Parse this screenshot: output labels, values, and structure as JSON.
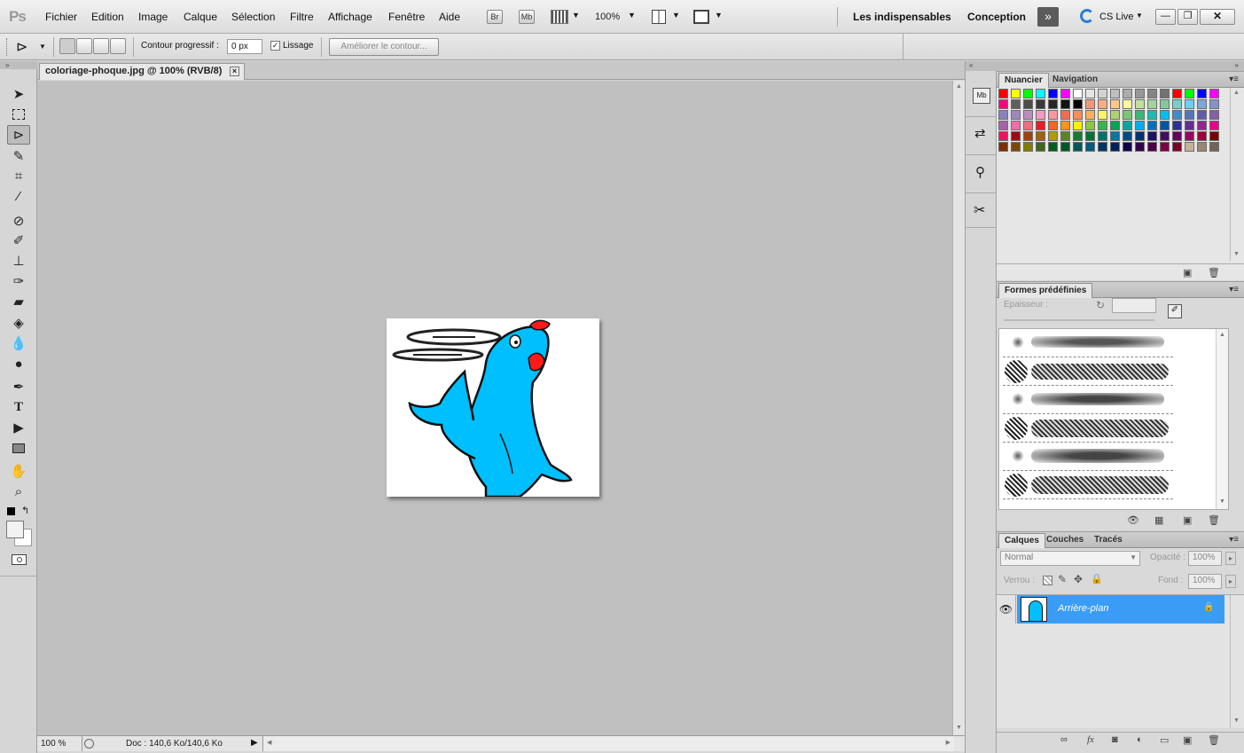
{
  "app": {
    "logo": "Ps"
  },
  "menu": [
    "Fichier",
    "Edition",
    "Image",
    "Calque",
    "Sélection",
    "Filtre",
    "Affichage",
    "Fenêtre",
    "Aide"
  ],
  "appbar": {
    "br_label": "Br",
    "mb_label": "Mb",
    "zoom": "100%"
  },
  "workspaces": {
    "essentials": "Les indispensables",
    "design": "Conception",
    "cslive": "CS Live"
  },
  "options": {
    "feather_label": "Contour progressif :",
    "feather_value": "0 px",
    "antialias_label": "Lissage",
    "refine_label": "Améliorer le contour..."
  },
  "document": {
    "tab_title": "coloriage-phoque.jpg @ 100% (RVB/8)",
    "close": "×"
  },
  "status": {
    "zoom": "100 %",
    "doc": "Doc : 140,6 Ko/140,6 Ko"
  },
  "swatches_panel": {
    "tabs": [
      "Nuancier",
      "Navigation"
    ]
  },
  "swatch_colors": [
    [
      "#ff0000",
      "#ffff00",
      "#00ff00",
      "#00ffff",
      "#0000ff",
      "#ff00ff",
      "#ffffff",
      "#e6e6e6",
      "#d2d2d2",
      "#bfbfbf",
      "#acacac",
      "#989898",
      "#858585",
      "#727272",
      "#ff0000",
      "#00ff00",
      "#0000ff",
      "#ff00ff"
    ],
    [
      "#ff007f",
      "#5f5f5f",
      "#4c4c4c",
      "#393939",
      "#262626",
      "#131313",
      "#000000",
      "#f7977a",
      "#f9ad81",
      "#fdc68a",
      "#fff79a",
      "#c4df9b",
      "#a3d39c",
      "#82ca9d",
      "#7bcdc8",
      "#6ecff6",
      "#7ea7d8",
      "#8493ca"
    ],
    [
      "#8882be",
      "#a187be",
      "#bc8dbf",
      "#f49ac2",
      "#f6989d",
      "#f26c4f",
      "#f68e55",
      "#fbaf5c",
      "#fff467",
      "#acd372",
      "#7cc576",
      "#3bb878",
      "#1abbb4",
      "#00bff3",
      "#438ccb",
      "#5574b9",
      "#605ca8",
      "#855fa8"
    ],
    [
      "#a763a8",
      "#f06ea9",
      "#f26d7d",
      "#ed1c24",
      "#f26522",
      "#f7941d",
      "#fff200",
      "#8dc73f",
      "#39b54a",
      "#00a651",
      "#00a99d",
      "#00aeef",
      "#0072bc",
      "#0054a6",
      "#2e3192",
      "#662d91",
      "#92278f",
      "#ec008c"
    ],
    [
      "#ed145b",
      "#9e0b0f",
      "#a0410d",
      "#a36209",
      "#aba000",
      "#598527",
      "#1a7b30",
      "#007236",
      "#00746b",
      "#0076a3",
      "#004b80",
      "#003471",
      "#1b1464",
      "#440e62",
      "#630460",
      "#9e005d",
      "#9e0039",
      "#790000"
    ],
    [
      "#7b2e00",
      "#7d4900",
      "#827b00",
      "#406618",
      "#005e20",
      "#005826",
      "#005952",
      "#005b7f",
      "#003663",
      "#002157",
      "#0d004c",
      "#32004b",
      "#4b0049",
      "#7b0046",
      "#7a0026",
      "#c7b299",
      "#998675",
      "#736357"
    ]
  ],
  "shapes_panel": {
    "title": "Formes prédéfinies",
    "thickness_label": "Epaisseur :"
  },
  "layers_panel": {
    "tabs": [
      "Calques",
      "Couches",
      "Tracés"
    ],
    "blend_mode": "Normal",
    "opacity_label": "Opacité :",
    "opacity": "100%",
    "lock_label": "Verrou :",
    "fill_label": "Fond :",
    "fill": "100%",
    "layer_name": "Arrière-plan"
  },
  "colors": {
    "accent": "#3b9cf6",
    "seal": "#00bfff"
  }
}
